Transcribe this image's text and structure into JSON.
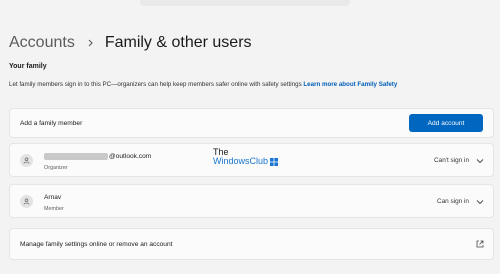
{
  "breadcrumb": {
    "parent": "Accounts",
    "current": "Family & other users"
  },
  "family_section": {
    "title": "Your family",
    "description": "Let family members sign in to this PC—organizers can help keep members safer online with safety settings",
    "learn_more": "Learn more about Family Safety"
  },
  "add_member": {
    "label": "Add a family member",
    "button_label": "Add account"
  },
  "users": [
    {
      "email_visible": "@outlook.com",
      "role": "Organizer",
      "status": "Can't sign in"
    },
    {
      "name": "Arnav",
      "role": "Member",
      "status": "Can sign in"
    }
  ],
  "manage": {
    "label": "Manage family settings online or remove an account"
  },
  "watermark": {
    "line1": "The",
    "line2": "WindowsClub"
  },
  "colors": {
    "accent": "#0067c0",
    "link": "#005fb8",
    "background": "#f3f3f3",
    "card": "#fbfbfb"
  },
  "icons": {
    "breadcrumb_separator": "chevron-right-icon",
    "avatar": "person-icon",
    "expand": "chevron-down-icon",
    "external": "open-external-icon"
  }
}
